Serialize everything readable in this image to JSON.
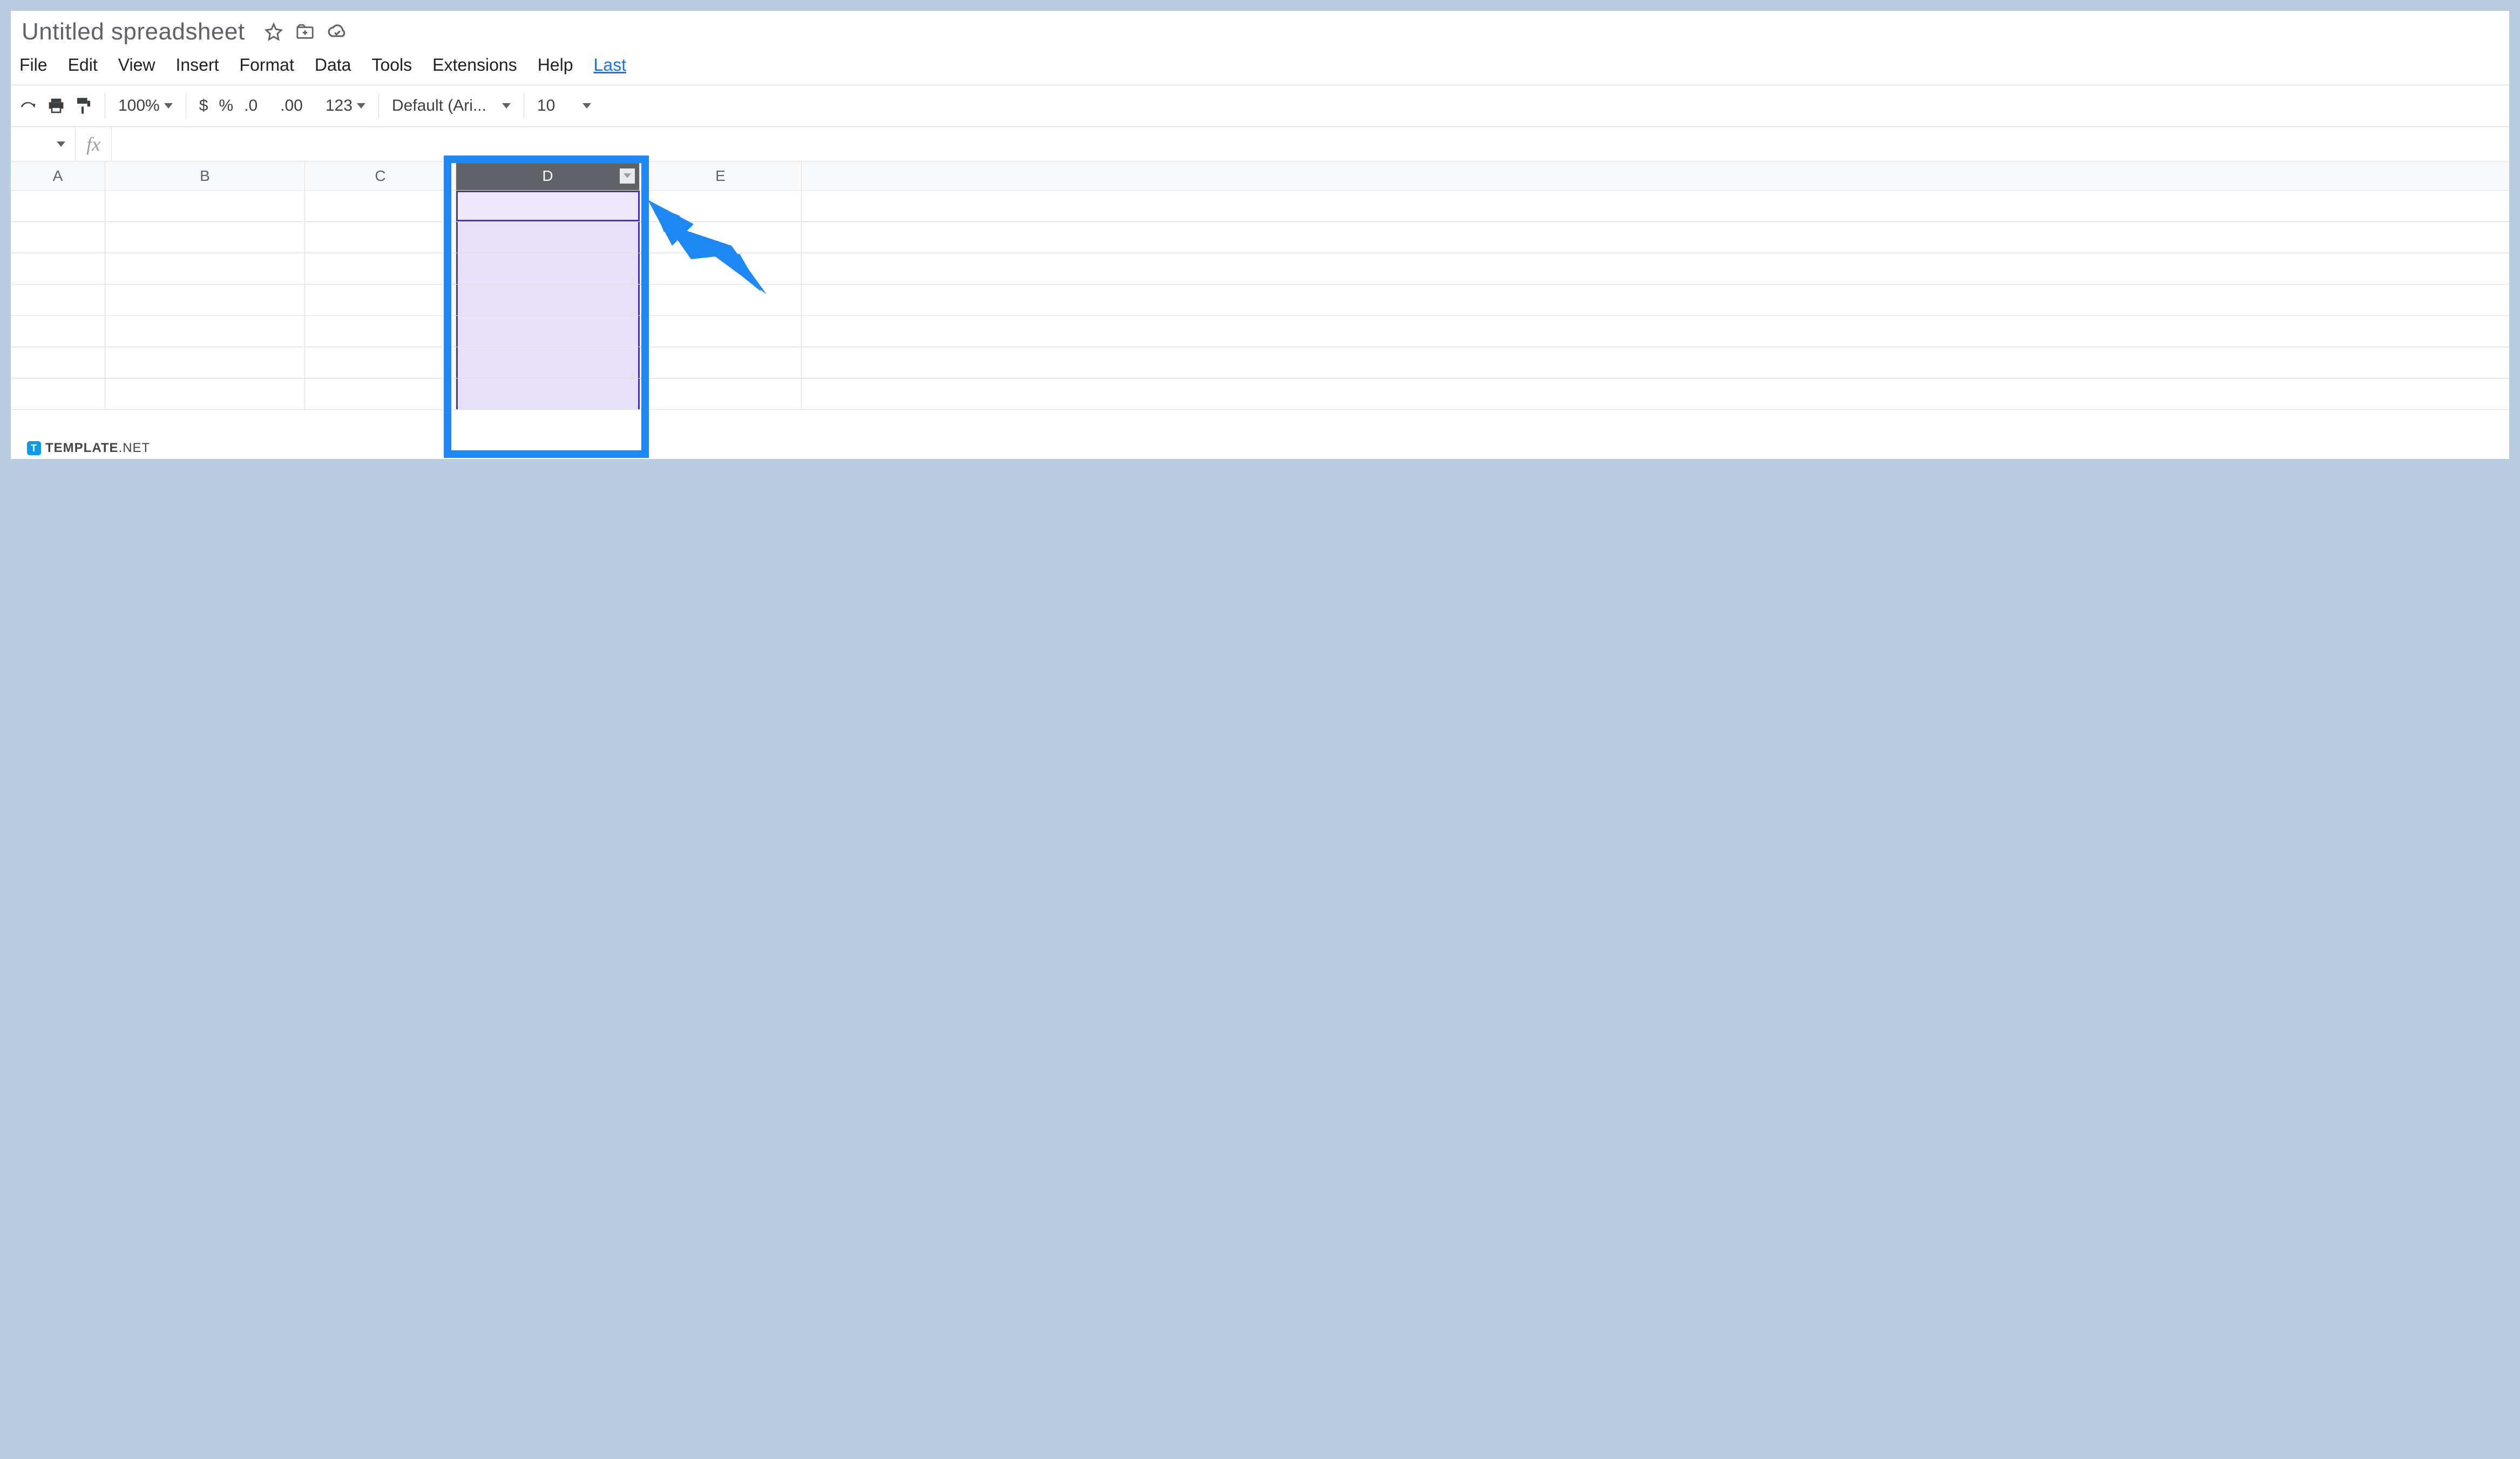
{
  "title": "Untitled spreadsheet",
  "menu": {
    "file": "File",
    "edit": "Edit",
    "view": "View",
    "insert": "Insert",
    "format": "Format",
    "data": "Data",
    "tools": "Tools",
    "extensions": "Extensions",
    "help": "Help",
    "last": "Last"
  },
  "toolbar": {
    "zoom": "100%",
    "currency": "$",
    "percent": "%",
    "dec_decrease": ".0",
    "dec_increase": ".00",
    "number_format": "123",
    "font": "Default (Ari...",
    "font_size": "10"
  },
  "fx": {
    "label": "fx"
  },
  "columns": {
    "A": "A",
    "B": "B",
    "C": "C",
    "D": "D",
    "E": "E"
  },
  "selected_column": "D",
  "watermark": {
    "badge": "T",
    "brand": "TEMPLATE",
    "suffix": ".NET"
  }
}
